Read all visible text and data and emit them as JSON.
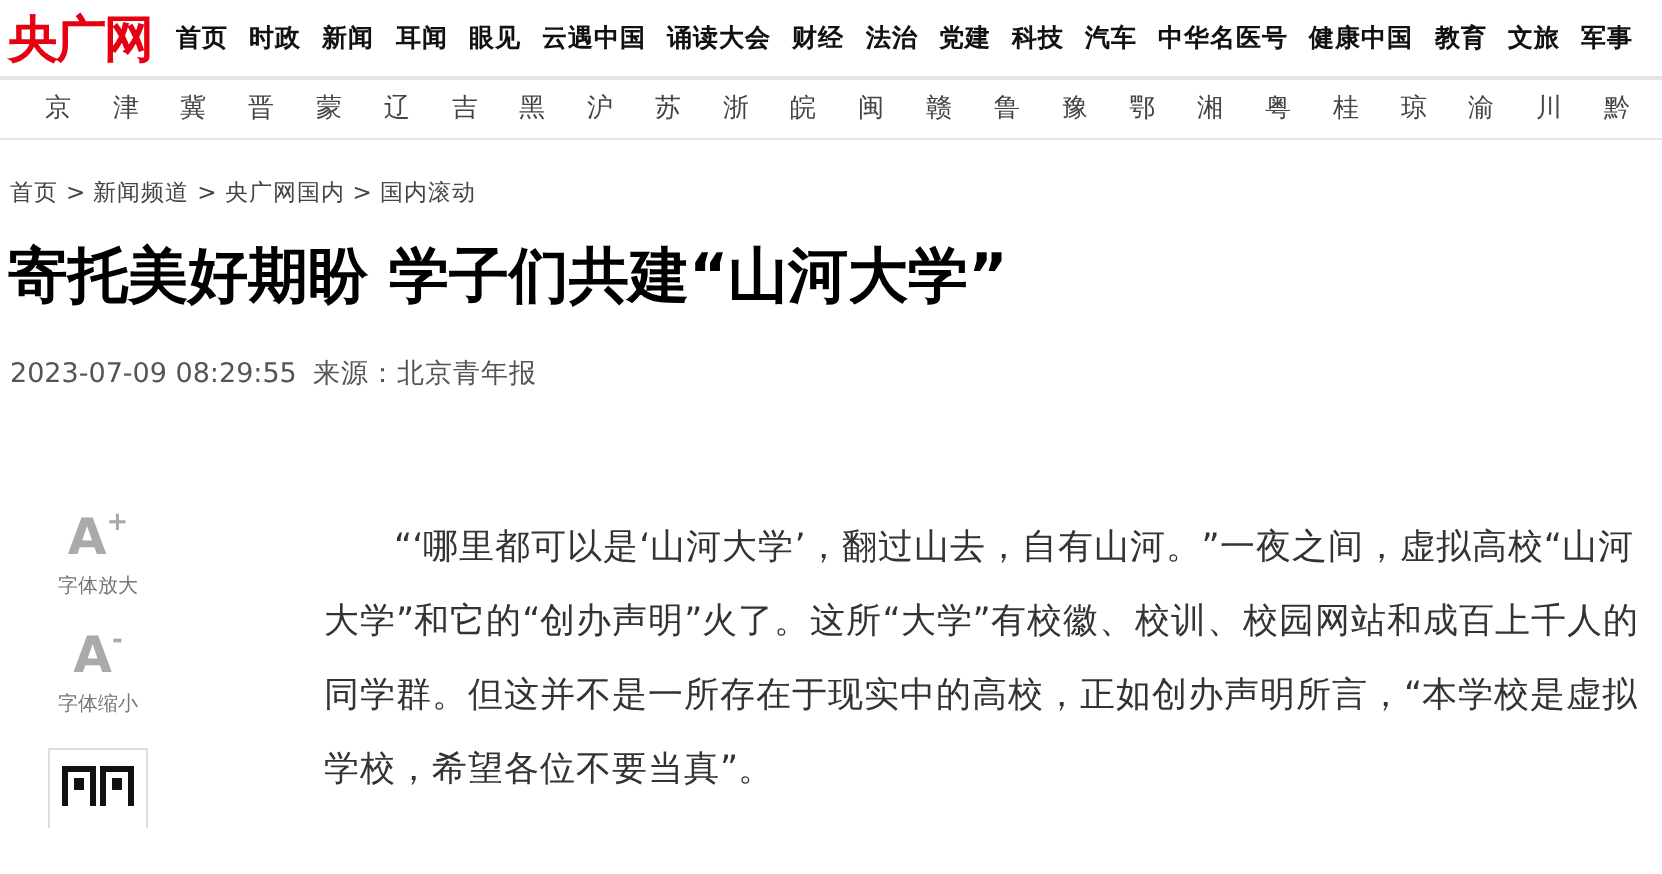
{
  "logo": "央广网",
  "nav": [
    "首页",
    "时政",
    "新闻",
    "耳闻",
    "眼见",
    "云遇中国",
    "诵读大会",
    "财经",
    "法治",
    "党建",
    "科技",
    "汽车",
    "中华名医号",
    "健康中国",
    "教育",
    "文旅",
    "军事"
  ],
  "regions": [
    "京",
    "津",
    "冀",
    "晋",
    "蒙",
    "辽",
    "吉",
    "黑",
    "沪",
    "苏",
    "浙",
    "皖",
    "闽",
    "赣",
    "鲁",
    "豫",
    "鄂",
    "湘",
    "粤",
    "桂",
    "琼",
    "渝",
    "川",
    "黔"
  ],
  "breadcrumb": [
    "首页",
    "新闻频道",
    "央广网国内",
    "国内滚动"
  ],
  "breadcrumb_separator": ">",
  "article": {
    "title": "寄托美好期盼 学子们共建“山河大学”",
    "time": "2023-07-09 08:29:55",
    "source_label": "来源：",
    "source": "北京青年报",
    "paragraph": "“‘哪里都可以是‘山河大学’，翻过山去，自有山河。”一夜之间，虚拟高校“山河大学”和它的“创办声明”火了。这所“大学”有校徽、校训、校园网站和成百上千人的同学群。但这并不是一所存在于现实中的高校，正如创办声明所言，“本学校是虚拟学校，希望各位不要当真”。"
  },
  "tools": [
    {
      "kind": "enlarge",
      "glyph": "A",
      "sup": "+",
      "label": "字体放大"
    },
    {
      "kind": "shrink",
      "glyph": "A",
      "sup": "-",
      "label": "字体缩小"
    },
    {
      "kind": "qrcode"
    }
  ]
}
